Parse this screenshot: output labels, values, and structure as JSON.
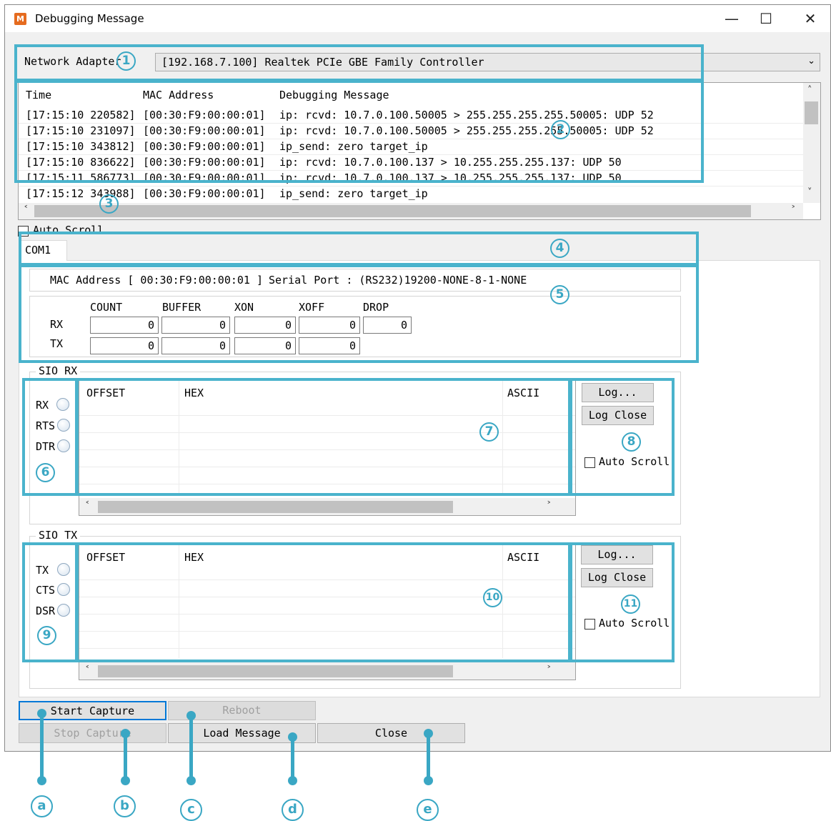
{
  "window": {
    "title": "Debugging Message",
    "icon_letter": "M",
    "minimize": "—",
    "maximize": "☐",
    "close": "✕"
  },
  "network": {
    "label": "Network Adapter",
    "selected": "[192.168.7.100] Realtek PCIe GBE Family Controller"
  },
  "log": {
    "columns": [
      "Time",
      "MAC Address",
      "Debugging Message"
    ],
    "rows": [
      [
        "[17:15:10 220582]",
        "[00:30:F9:00:00:01]",
        "ip: rcvd: 10.7.0.100.50005 > 255.255.255.255.50005: UDP 52"
      ],
      [
        "[17:15:10 231097]",
        "[00:30:F9:00:00:01]",
        "ip: rcvd: 10.7.0.100.50005 > 255.255.255.255.50005: UDP 52"
      ],
      [
        "[17:15:10 343812]",
        "[00:30:F9:00:00:01]",
        "ip_send: zero target_ip"
      ],
      [
        "[17:15:10 836622]",
        "[00:30:F9:00:00:01]",
        "ip: rcvd: 10.7.0.100.137 > 10.255.255.255.137: UDP 50"
      ],
      [
        "[17:15:11 586773]",
        "[00:30:F9:00:00:01]",
        "ip: rcvd: 10.7.0.100.137 > 10.255.255.255.137: UDP 50"
      ],
      [
        "[17:15:12 343988]",
        "[00:30:F9:00:00:01]",
        "ip_send: zero target_ip"
      ]
    ],
    "auto_scroll_label": "Auto Scroll"
  },
  "com": {
    "tab": "COM1",
    "mac_line": "MAC Address [ 00:30:F9:00:00:01 ]",
    "serial_line": "Serial Port : (RS232)19200-NONE-8-1-NONE",
    "headers": [
      "COUNT",
      "BUFFER",
      "XON",
      "XOFF",
      "DROP"
    ],
    "rx_label": "RX",
    "tx_label": "TX",
    "rx_values": [
      "0",
      "0",
      "0",
      "0",
      "0"
    ],
    "tx_values": [
      "0",
      "0",
      "0",
      "0"
    ]
  },
  "sio_rx": {
    "title": "SIO RX",
    "leds": [
      "RX",
      "RTS",
      "DTR"
    ],
    "columns": [
      "OFFSET",
      "HEX",
      "ASCII"
    ],
    "log_button": "Log...",
    "log_close_button": "Log Close",
    "auto_scroll_label": "Auto Scroll"
  },
  "sio_tx": {
    "title": "SIO TX",
    "leds": [
      "TX",
      "CTS",
      "DSR"
    ],
    "columns": [
      "OFFSET",
      "HEX",
      "ASCII"
    ],
    "log_button": "Log...",
    "log_close_button": "Log Close",
    "auto_scroll_label": "Auto Scroll"
  },
  "buttons": {
    "start_capture": "Start Capture",
    "stop_capture": "Stop Capture",
    "reboot": "Reboot",
    "load_message": "Load Message",
    "close": "Close"
  },
  "markers": {
    "m1": "1",
    "m2": "2",
    "m3": "3",
    "m4": "4",
    "m5": "5",
    "m6": "6",
    "m7": "7",
    "m8": "8",
    "m9": "9",
    "m10": "10",
    "m11": "11",
    "a": "a",
    "b": "b",
    "c": "c",
    "d": "d",
    "e": "e"
  },
  "colors": {
    "annotation": "#4ab3cc",
    "window_bg": "#f0f0f0",
    "focus_border": "#0078d7"
  }
}
